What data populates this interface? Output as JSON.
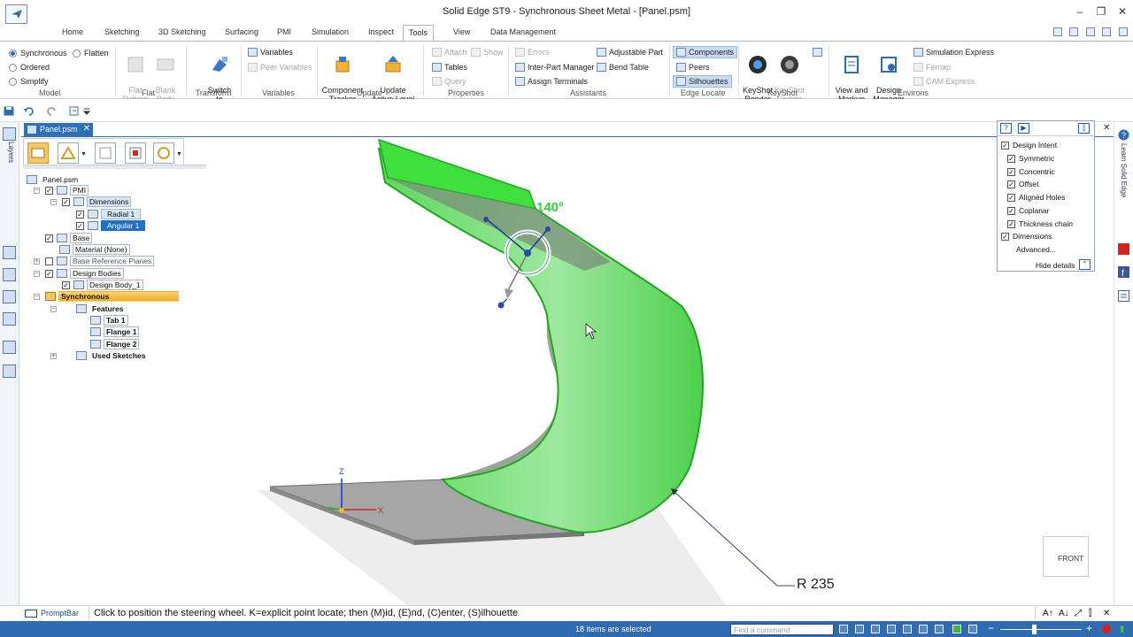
{
  "window": {
    "title": "Solid Edge ST9 - Synchronous Sheet Metal - [Panel.psm]",
    "minimize": "–",
    "restore": "❐",
    "close": "✕"
  },
  "ribbon_tabs": [
    {
      "label": "Home"
    },
    {
      "label": "Sketching"
    },
    {
      "label": "3D Sketching"
    },
    {
      "label": "Surfacing"
    },
    {
      "label": "PMI"
    },
    {
      "label": "Simulation"
    },
    {
      "label": "Inspect"
    },
    {
      "label": "Tools"
    },
    {
      "label": "View"
    },
    {
      "label": "Data Management"
    }
  ],
  "ribbon": {
    "model": {
      "label": "Model",
      "synchronous": "Synchronous",
      "flatten": "Flatten",
      "ordered": "Ordered",
      "simplify": "Simplify"
    },
    "flat": {
      "label": "Flat",
      "flat_pattern": "Flat\nPattern",
      "blank_body": "Blank\nBody"
    },
    "transform": {
      "label": "Transform",
      "switch_to": "Switch\nto"
    },
    "variables": {
      "label": "Variables",
      "variables": "Variables",
      "peer_variables": "Peer Variables"
    },
    "update": {
      "label": "Update",
      "component_tracker": "Component\nTracker",
      "update_active_level": "Update\nActive Level"
    },
    "properties": {
      "label": "Properties",
      "attach": "Attach",
      "show": "Show",
      "tables": "Tables",
      "query": "Query"
    },
    "assistants": {
      "label": "Assistants",
      "errors": "Errors",
      "inter_part_manager": "Inter-Part Manager",
      "assign_terminals": "Assign Terminals",
      "adjustable_part": "Adjustable Part",
      "bend_table": "Bend Table"
    },
    "edge_locate": {
      "label": "Edge Locate",
      "components": "Components",
      "peers": "Peers",
      "silhouettes": "Silhouettes"
    },
    "keyshot": {
      "label": "KeyShot",
      "render": "KeyShot\nRender",
      "update": "KeyShot\nUpdate"
    },
    "environs": {
      "label": "Environs",
      "view_markup": "View and\nMarkup",
      "design_manager": "Design\nManager",
      "simulation_express": "Simulation Express",
      "femap": "Femap",
      "cam_express": "CAM Express"
    }
  },
  "left_bar": {
    "layers": "Layers"
  },
  "right_bar": {
    "learn": "Learn Solid Edge"
  },
  "document_tab": {
    "label": "Panel.psm",
    "close": "✕"
  },
  "tree": {
    "root": "Panel.psm",
    "pmi": "PMI",
    "dimensions": "Dimensions",
    "radial": "Radial 1",
    "angular": "Angular 1",
    "base": "Base",
    "material": "Material (None)",
    "base_reference_planes": "Base Reference Planes",
    "design_bodies": "Design Bodies",
    "design_body": "Design Body_1",
    "synchronous": "Synchronous",
    "features": "Features",
    "tab": "Tab 1",
    "flange1": "Flange 1",
    "flange2": "Flange 2",
    "used_sketches": "Used Sketches"
  },
  "viewport": {
    "angle_dim": "140°",
    "radius_dim": "R 235",
    "axis_z": "Z",
    "axis_x": "X",
    "view_cube": "FRONT",
    "colors": {
      "selection": "#37f03a",
      "selection_dark": "#1fa71f",
      "body_gray": "#a8a8a8",
      "shadow": "#e9e9e9"
    }
  },
  "selection_panel": {
    "design_intent": "Design Intent",
    "symmetric": "Symmetric",
    "concentric": "Concentric",
    "offset": "Offset",
    "aligned_holes": "Aligned Holes",
    "coplanar": "Coplanar",
    "thickness_chain": "Thickness chain",
    "dimensions": "Dimensions",
    "advanced": "Advanced...",
    "hide_details": "Hide details",
    "help": "?",
    "arrow": "▶",
    "pin": "⫿",
    "close": "✕"
  },
  "prompt_bar": {
    "label": "PromptBar",
    "text": "Click to position the steering wheel.  K=explicit point locate; then (M)id, (E)nd, (C)enter, (S)ilhouette"
  },
  "status_bar": {
    "text": "18 items are selected",
    "find_placeholder": "Find a command"
  }
}
